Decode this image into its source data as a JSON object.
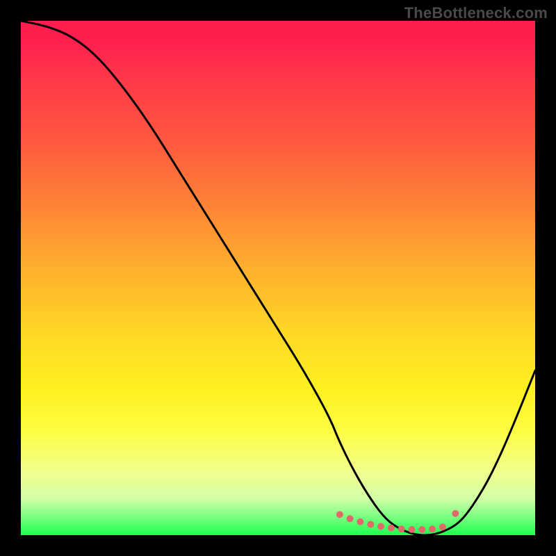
{
  "watermark": "TheBottleneck.com",
  "chart_data": {
    "type": "line",
    "title": "",
    "xlabel": "",
    "ylabel": "",
    "xlim": [
      0,
      100
    ],
    "ylim": [
      0,
      100
    ],
    "series": [
      {
        "name": "bottleneck-curve",
        "x": [
          0,
          5,
          10,
          15,
          20,
          25,
          30,
          35,
          40,
          45,
          50,
          55,
          60,
          62,
          65,
          68,
          71,
          74,
          77,
          80,
          83,
          86,
          90,
          93,
          96,
          100
        ],
        "y": [
          100,
          99,
          97,
          93,
          87,
          80,
          72,
          64,
          56,
          48,
          40,
          32,
          23,
          18,
          12,
          7,
          3,
          1,
          0,
          0,
          1,
          3,
          9,
          15,
          22,
          32
        ]
      }
    ],
    "markers": {
      "name": "highlight-dots",
      "color": "#e06a6a",
      "radius_px": 5,
      "x": [
        62,
        64,
        66,
        68,
        70,
        72,
        74,
        76,
        78,
        80,
        82,
        84.5
      ],
      "y": [
        4.0,
        3.2,
        2.6,
        2.1,
        1.7,
        1.4,
        1.2,
        1.1,
        1.1,
        1.2,
        1.6,
        4.2
      ]
    },
    "gradient_stops": [
      {
        "pos": 0,
        "color": "#ff1f4f"
      },
      {
        "pos": 24,
        "color": "#ff5a3f"
      },
      {
        "pos": 48,
        "color": "#ffaf2e"
      },
      {
        "pos": 72,
        "color": "#fff120"
      },
      {
        "pos": 93,
        "color": "#d1ffa6"
      },
      {
        "pos": 100,
        "color": "#1eff4f"
      }
    ]
  }
}
